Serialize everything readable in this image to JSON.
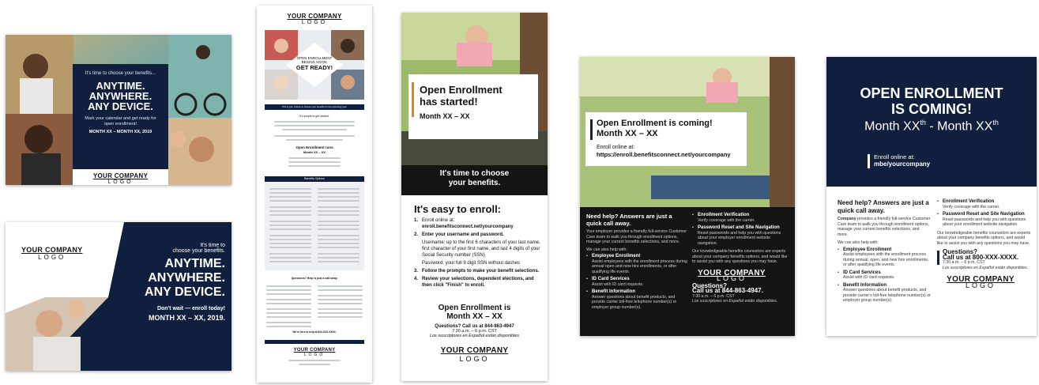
{
  "colors": {
    "navy": "#0f1f3d",
    "orange_accent": "#f07c22",
    "dark": "#141414"
  },
  "card_a": {
    "intro": "It's time to choose your benefits...",
    "headline": [
      "ANYTIME.",
      "ANYWHERE.",
      "ANY DEVICE."
    ],
    "body": "Mark your calendar and get ready for open enrollment!",
    "dates": "MONTH XX – MONTH XX, 2019",
    "logo_top": "YOUR COMPANY",
    "logo_bottom": "LOGO"
  },
  "card_b": {
    "logo_top": "YOUR COMPANY",
    "logo_bottom": "LOGO",
    "intro_1": "It's time to",
    "intro_2": "choose your benefits.",
    "headline": [
      "ANYTIME.",
      "ANYWHERE.",
      "ANY DEVICE."
    ],
    "cta": "Don't wait — enroll today!",
    "dates": "MONTH XX – XX, 2019."
  },
  "card_c": {
    "logo_top": "YOUR COMPANY",
    "logo_bottom": "LOGO",
    "badge_1": "OPEN ENROLLMENT",
    "badge_2": "BEGINS SOON.",
    "badge_3": "GET READY!",
    "band": "This is your chance to choose your benefits for the upcoming year.",
    "subtitle": "It's simple to get started.",
    "runs": "Open Enrollment runs",
    "runs_dates": "Month XX – XX",
    "options_title": "Benefits Options",
    "help_title": "Questions? Help is just a call away.",
    "help_footer": "We're here to help at 844-XXX-XXXX.",
    "footer_logo_top": "YOUR COMPANY",
    "footer_logo_bottom": "LOGO"
  },
  "card_d": {
    "headline_1": "Open Enrollment",
    "headline_2": "has started!",
    "month": "Month XX – XX",
    "band_1": "It's time to choose",
    "band_2": "your benefits.",
    "steps_title": "It's easy to enroll:",
    "steps": [
      {
        "title": "Enroll online at:",
        "detail": "enroll.benefitsconnect.net/yourcompany"
      },
      {
        "title": "Enter your username and password.",
        "detail": "Username: up to the first 6 characters of your last name, first character of your first name, and last 4 digits of your Social Security number (SSN)"
      },
      {
        "title": "",
        "detail": "Password: your full 9 digit SSN without dashes"
      },
      {
        "title": "Follow the prompts to make your benefit selections.",
        "detail": ""
      },
      {
        "title": "Review your selections, dependent elections, and then click \"Finish\" to enroll.",
        "detail": ""
      }
    ],
    "step_numbers": [
      "1.",
      "2.",
      "3.",
      "4."
    ],
    "footer_title_1": "Open Enrollment is",
    "footer_title_2": "Month XX – XX",
    "call": "Questions? Call us at 844-863-4947",
    "hours": "7:30 a.m. – 6 p.m. CST",
    "spanish": "Los suscriptores en Español están disponibles",
    "logo_top": "YOUR COMPANY",
    "logo_bottom": "LOGO"
  },
  "card_e": {
    "headline_1": "Open Enrollment is coming!",
    "headline_2": "Month XX – XX",
    "enroll_label": "Enroll online at:",
    "enroll_url": "https://enroll.benefitsconnect.net/yourcompany",
    "help_title": "Need help? Answers are just a quick call away.",
    "help_body": "Your employer provides a friendly full-service Customer Care team to walk you through enrollment options, manage your current benefits selections, and more.",
    "also": "We can also help with:",
    "left_items": [
      {
        "title": "Employee Enrollment",
        "body": "Assist employees with the enrollment process during annual open and new hire enrollments, or after qualifying life events."
      },
      {
        "title": "ID Card Services",
        "body": "Assist with ID card requests."
      },
      {
        "title": "Benefit Information",
        "body": "Answer questions about benefit products, and provide carrier toll-free telephone number(s) or employer group number(s)."
      }
    ],
    "right_items": [
      {
        "title": "Enrollment Verification",
        "body": "Verify coverage with the carrier."
      },
      {
        "title": "Password Reset and Site Navigation",
        "body": "Reset passwords and help you with questions about your employer enrollment website navigation."
      }
    ],
    "experts": "Our knowledgeable benefits counselors are experts about your company benefits options, and would like to assist you with any questions you may have.",
    "logo_top": "YOUR COMPANY",
    "logo_bottom": "LOGO",
    "questions": "Questions?",
    "call": "Call us at 844-863-4947.",
    "hours": "7:30 a.m. – 6 p.m. CST",
    "spanish": "Los suscriptores en Español están disponibles."
  },
  "card_f": {
    "headline_1": "OPEN ENROLLMENT",
    "headline_2": "IS COMING!",
    "month_a": "Month XX",
    "month_b": " - Month XX",
    "month_sup": "th",
    "enroll_label": "Enroll online at:",
    "enroll_url": "mbe/yourcompany",
    "help_title": "Need help? Answers are just a quick call away.",
    "help_lead": "Company",
    "help_body": " provides a friendly full-service Customer Care team to walk you through enrollment options, manage your current benefits selections, and more.",
    "also": "We can also help with:",
    "left_items": [
      {
        "title": "Employee Enrollment",
        "body": "Assist employees with the enrollment process during annual, open, and new hire enrollments, or after qualifying life events."
      },
      {
        "title": "ID Card Services",
        "body": "Assist with ID card requests."
      },
      {
        "title": "Benefit Information",
        "body": "Answer questions about benefit products, and provide carrier's toll-free telephone number(s) or employer group number(s)."
      }
    ],
    "right_items": [
      {
        "title": "Enrollment Verification",
        "body": "Verify coverage with the carrier."
      },
      {
        "title": "Password Reset and Site Navigation",
        "body": "Reset passwords and help you with questions about your enrollment website navigation."
      }
    ],
    "experts": "Our knowledgeable benefits counselors are experts about your company benefits options, and would like to assist you with any questions you may have.",
    "questions": "Questions?",
    "call": "Call us at 800-XXX-XXXX.",
    "hours": "7:30 a.m. – 6 p.m. CST",
    "spanish": "Los suscriptores en Español están disponibles.",
    "logo_top": "YOUR COMPANY",
    "logo_bottom": "LOGO"
  }
}
